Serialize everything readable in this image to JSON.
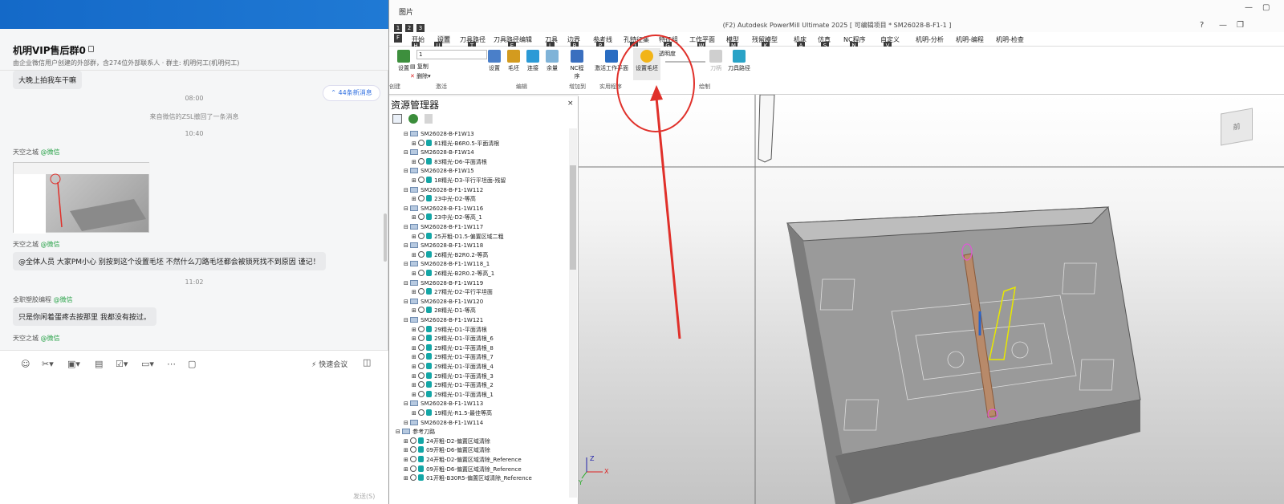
{
  "chat": {
    "group_title": "机明VIP售后群0",
    "group_subtitle": "由企业微信用户创建的外部群，含274位外部联系人 · 群主: 机明何工(机明何工)",
    "new_messages_label": "44条新消息",
    "messages": [
      {
        "type": "bubble",
        "text": "大晚上拍我车干嘛"
      },
      {
        "type": "time",
        "text": "08:00"
      },
      {
        "type": "system",
        "text": "来自微信的ZSL撤回了一条消息"
      },
      {
        "type": "time",
        "text": "10:40"
      },
      {
        "type": "sender",
        "name": "天空之城",
        "source": "@微信"
      },
      {
        "type": "image"
      },
      {
        "type": "sender",
        "name": "天空之城",
        "source": "@微信"
      },
      {
        "type": "bubble",
        "text": "@全体人员 大家PM小心 别按到这个设置毛坯 不然什么刀路毛坯都会被锁死找不到原因 谨记！"
      },
      {
        "type": "time",
        "text": "11:02"
      },
      {
        "type": "sender",
        "name": "全职塑胶编程",
        "source": "@微信"
      },
      {
        "type": "bubble",
        "text": "只是你闲着蛋疼去按那里  我都没有按过。"
      },
      {
        "type": "sender",
        "name": "天空之城",
        "source": "@微信"
      }
    ],
    "compose": {
      "quick_meeting": "快速会议",
      "send_label": "发送(S)"
    }
  },
  "powermill": {
    "window_title": "图片",
    "app_title": "(F2) Autodesk PowerMill Ultimate 2025    [ 可编辑项目 * SM26028-B-F1-1 ]",
    "menus": [
      "开始",
      "设置",
      "刀具路径",
      "刀具路径编辑",
      "刀具",
      "边界",
      "参考线",
      "孔特征集",
      "特征组",
      "工作平面",
      "模型",
      "残留模型",
      "机床",
      "仿真",
      "NC程序",
      "自定义",
      "机明-分析",
      "机明-编程",
      "机明-检查"
    ],
    "keytips_top": [
      "1",
      "2",
      "3"
    ],
    "keytips_menu": [
      "F",
      "H",
      "U",
      "T",
      "E",
      "L",
      "B",
      "P",
      "O",
      "G",
      "W",
      "M",
      "K",
      "A",
      "S",
      "N",
      "V"
    ],
    "ribbon": {
      "combo_value": "1",
      "groups": [
        {
          "name": "创建",
          "buttons": [
            "设置"
          ]
        },
        {
          "name": "激活",
          "buttons": [
            "复制",
            "删除"
          ]
        },
        {
          "name": "编辑",
          "buttons": [
            "设置",
            "毛坯",
            "连接",
            "余量"
          ]
        },
        {
          "name": "增加到",
          "buttons": [
            "NC程序"
          ]
        },
        {
          "name": "实用程序",
          "buttons": [
            "激活工作平面"
          ]
        },
        {
          "name": "绘制",
          "buttons": [
            "设置毛坯",
            "透明度",
            "刀柄",
            "刀具路径"
          ]
        }
      ]
    },
    "explorer": {
      "title": "资源管理器",
      "close": "×",
      "items": [
        {
          "level": 1,
          "kind": "folder",
          "text": "SM26028-B-F1W13"
        },
        {
          "level": 2,
          "kind": "path",
          "text": "81精光-B6R0.5-平面清根"
        },
        {
          "level": 1,
          "kind": "folder",
          "text": "SM26028-B-F1W14"
        },
        {
          "level": 2,
          "kind": "path",
          "text": "83精光-D6-平面清根"
        },
        {
          "level": 1,
          "kind": "folder",
          "text": "SM26028-B-F1W15"
        },
        {
          "level": 2,
          "kind": "path",
          "text": "18精光-D3-平行平坦面-残留"
        },
        {
          "level": 1,
          "kind": "folder",
          "text": "SM26028-B-F1-1W112"
        },
        {
          "level": 2,
          "kind": "path",
          "text": "23中光-D2-等高"
        },
        {
          "level": 1,
          "kind": "folder",
          "text": "SM26028-B-F1-1W116"
        },
        {
          "level": 2,
          "kind": "path",
          "text": "23中光-D2-等高_1"
        },
        {
          "level": 1,
          "kind": "folder",
          "text": "SM26028-B-F1-1W117"
        },
        {
          "level": 2,
          "kind": "path",
          "text": "25开粗-D1.5-偏置区域二粗"
        },
        {
          "level": 1,
          "kind": "folder",
          "text": "SM26028-B-F1-1W118"
        },
        {
          "level": 2,
          "kind": "path",
          "text": "26精光-B2R0.2-等高"
        },
        {
          "level": 1,
          "kind": "folder",
          "text": "SM26028-B-F1-1W118_1"
        },
        {
          "level": 2,
          "kind": "path",
          "text": "26精光-B2R0.2-等高_1"
        },
        {
          "level": 1,
          "kind": "folder",
          "text": "SM26028-B-F1-1W119"
        },
        {
          "level": 2,
          "kind": "path",
          "text": "27精光-D2-平行平坦面"
        },
        {
          "level": 1,
          "kind": "folder",
          "text": "SM26028-B-F1-1W120"
        },
        {
          "level": 2,
          "kind": "path",
          "text": "28精光-D1-等高"
        },
        {
          "level": 1,
          "kind": "folder",
          "text": "SM26028-B-F1-1W121"
        },
        {
          "level": 2,
          "kind": "path",
          "text": "29精光-D1-平面清根"
        },
        {
          "level": 2,
          "kind": "path",
          "text": "29精光-D1-平面清根_6"
        },
        {
          "level": 2,
          "kind": "path",
          "text": "29精光-D1-平面清根_8"
        },
        {
          "level": 2,
          "kind": "path",
          "text": "29精光-D1-平面清根_7"
        },
        {
          "level": 2,
          "kind": "path",
          "text": "29精光-D1-平面清根_4"
        },
        {
          "level": 2,
          "kind": "path",
          "text": "29精光-D1-平面清根_3"
        },
        {
          "level": 2,
          "kind": "path",
          "text": "29精光-D1-平面清根_2"
        },
        {
          "level": 2,
          "kind": "path",
          "text": "29精光-D1-平面清根_1"
        },
        {
          "level": 1,
          "kind": "folder",
          "text": "SM26028-B-F1-1W113"
        },
        {
          "level": 2,
          "kind": "path",
          "text": "19精光-R1.5-最佳等高"
        },
        {
          "level": 1,
          "kind": "folder",
          "text": "SM26028-B-F1-1W114"
        },
        {
          "level": 0,
          "kind": "folder",
          "text": "参考刀路"
        },
        {
          "level": 1,
          "kind": "path",
          "text": "24开粗-D2-偏置区域清除"
        },
        {
          "level": 1,
          "kind": "path",
          "text": "09开粗-D6-偏置区域清除"
        },
        {
          "level": 1,
          "kind": "path",
          "text": "24开粗-D2-偏置区域清除_Reference"
        },
        {
          "level": 1,
          "kind": "path",
          "text": "09开粗-D6-偏置区域清除_Reference"
        },
        {
          "level": 1,
          "kind": "path",
          "text": "01开粗-B30R5-偏置区域清除_Reference"
        }
      ]
    },
    "viewport": {
      "cube_label": "前",
      "axis_labels": [
        "X",
        "Y",
        "Z"
      ],
      "annotation_color": "#e0302a"
    }
  },
  "colors": {
    "accent_blue": "#2f6fe0",
    "wechat_green": "#2aa34a",
    "annotation_red": "#e0302a",
    "toolpath_teal": "#14a6a6"
  }
}
